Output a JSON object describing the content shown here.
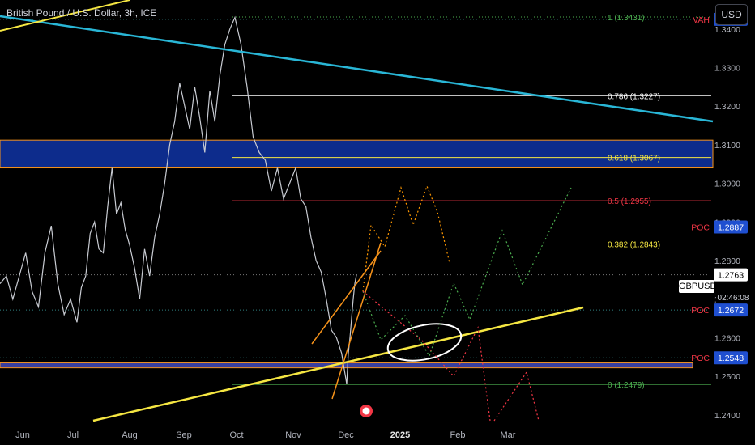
{
  "header": {
    "symbol_title": "British Pound / U.S. Dollar, 3h, ICE",
    "currency_button": "USD"
  },
  "colors": {
    "background": "#000000",
    "price_line": "#c8cbd2",
    "trend_cyan": "#29b6d6",
    "trend_yellow": "#f5e642",
    "zone_blue": "#0d2c8c",
    "poc_red": "#f23645",
    "fib_white": "#ffffff",
    "fib_yellow": "#f5e642",
    "fib_red": "#f23645",
    "fib_green": "#4caf50",
    "wedge_orange": "#f7931a",
    "projection_orange": "#ff9800",
    "projection_green": "#4caf50",
    "projection_red": "#f23645"
  },
  "chart_data": {
    "type": "line",
    "title": "British Pound / U.S. Dollar, 3h, ICE",
    "symbol": "GBPUSD",
    "last_price": 1.2763,
    "countdown": "02:46:08",
    "ylim": [
      1.2385,
      1.3475
    ],
    "x_tick_labels": [
      "Jun",
      "Jul",
      "Aug",
      "Sep",
      "Oct",
      "Nov",
      "Dec",
      "2025",
      "Feb",
      "Mar"
    ],
    "y_tick_labels": [
      "1.2400",
      "1.2500",
      "1.2600",
      "1.2700",
      "1.2800",
      "1.2900",
      "1.3000",
      "1.3100",
      "1.3200",
      "1.3300",
      "1.3400"
    ],
    "price_path": [
      [
        1.274,
        1.276,
        1.27,
        1.276,
        1.282,
        1.272,
        1.268,
        1.282,
        1.289,
        1.274,
        1.266,
        1.27,
        1.264
      ],
      [
        1.264,
        1.273,
        1.276,
        1.287,
        1.29,
        1.283,
        1.282,
        1.294,
        1.304,
        1.292,
        1.295,
        1.288,
        1.284
      ],
      [
        1.284,
        1.278,
        1.27,
        1.283,
        1.276,
        1.286,
        1.292,
        1.3,
        1.31,
        1.316,
        1.326,
        1.32
      ],
      [
        1.32,
        1.314,
        1.325,
        1.317,
        1.308,
        1.324,
        1.316,
        1.328,
        1.336,
        1.34,
        1.343
      ],
      [
        1.343,
        1.336,
        1.325,
        1.312,
        1.308,
        1.306,
        1.298,
        1.304,
        1.296,
        1.3,
        1.304
      ],
      [
        1.304,
        1.296,
        1.294,
        1.286,
        1.28,
        1.277,
        1.27,
        1.262,
        1.26,
        1.256,
        1.248
      ],
      [
        1.248,
        1.256,
        1.26,
        1.265,
        1.27,
        1.274,
        1.2763
      ]
    ],
    "levels": [
      {
        "label": "1 (1.3431)",
        "value": 1.3431,
        "color": "#4caf50",
        "style": "dotted"
      },
      {
        "label": "0.786 (1.3227)",
        "value": 1.3227,
        "color": "#ffffff",
        "style": "solid"
      },
      {
        "label": "0.618 (1.3067)",
        "value": 1.3067,
        "color": "#f5e642",
        "style": "solid"
      },
      {
        "label": "0.5 (1.2955)",
        "value": 1.2955,
        "color": "#f23645",
        "style": "solid"
      },
      {
        "label": "0.382 (1.2843)",
        "value": 1.2843,
        "color": "#f5e642",
        "style": "solid"
      },
      {
        "label": "0 (1.2479)",
        "value": 1.2479,
        "color": "#4caf50",
        "style": "solid"
      }
    ],
    "price_tags": [
      {
        "side_label": "VAH",
        "value": "1.3425",
        "price": 1.3425,
        "color": "#f23645"
      },
      {
        "side_label": "POC",
        "value": "1.2887",
        "price": 1.2887,
        "color": "#f23645"
      },
      {
        "side_label": "POC",
        "value": "1.2672",
        "price": 1.2672,
        "color": "#f23645"
      },
      {
        "side_label": "POC",
        "value": "1.2548",
        "price": 1.2548,
        "color": "#f23645"
      }
    ],
    "zones": [
      {
        "name": "resistance-zone",
        "from": 1.304,
        "to": 1.3112,
        "color": "#0d2c8c",
        "border": "#f7931a"
      },
      {
        "name": "support-zone",
        "from": 1.2522,
        "to": 1.2535,
        "color": "#3a3f9e",
        "border": "#f7931a"
      }
    ],
    "grid": false
  }
}
